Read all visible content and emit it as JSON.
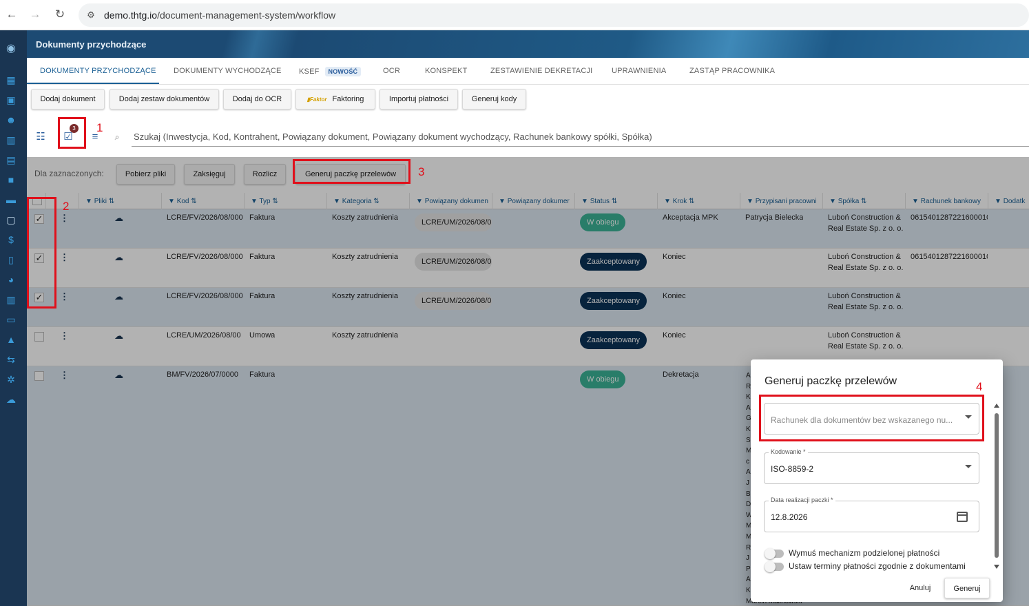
{
  "browser": {
    "url_host": "demo.thtg.io",
    "url_path": "/document-management-system/workflow"
  },
  "app": {
    "title": "Dokumenty przychodzące"
  },
  "tabs": [
    {
      "label": "DOKUMENTY PRZYCHODZĄCE"
    },
    {
      "label": "DOKUMENTY WYCHODZĄCE"
    },
    {
      "label": "KSEF",
      "badge": "NOWOŚĆ"
    },
    {
      "label": "OCR"
    },
    {
      "label": "KONSPEKT"
    },
    {
      "label": "ZESTAWIENIE DEKRETACJI"
    },
    {
      "label": "UPRAWNIENIA"
    },
    {
      "label": "ZASTĄP PRACOWNIKA"
    }
  ],
  "actions": {
    "add_document": "Dodaj dokument",
    "add_set": "Dodaj zestaw dokumentów",
    "add_ocr": "Dodaj do OCR",
    "faktor_logo": "Faktor",
    "factoring": "Faktoring",
    "import_payments": "Importuj płatności",
    "generate_codes": "Generuj kody"
  },
  "search": {
    "placeholder": "Szukaj (Inwestycja, Kod, Kontrahent, Powiązany dokument, Powiązany dokument wychodzący, Rachunek bankowy spółki, Spółka)",
    "selected_count": "3"
  },
  "selection": {
    "label": "Dla zaznaczonych:",
    "download": "Pobierz pliki",
    "post": "Zaksięguj",
    "settle": "Rozlicz",
    "generate_transfers": "Generuj paczkę przelewów"
  },
  "annotations": {
    "n1": "1",
    "n2": "2",
    "n3": "3",
    "n4": "4"
  },
  "columns": [
    "Pliki",
    "Kod",
    "Typ",
    "Kategoria",
    "Powiązany dokumen",
    "Powiązany dokumer",
    "Status",
    "Krok",
    "Przypisani pracowni",
    "Spółka",
    "Rachunek bankowy",
    "Dodatk"
  ],
  "rows": [
    {
      "checked": true,
      "kod": "LCRE/FV/2026/08/000",
      "typ": "Faktura",
      "kategoria": "Koszty zatrudnienia",
      "powiazany": "LCRE/UM/2026/08/0",
      "status": "W obiegu",
      "krok": "Akceptacja MPK",
      "pracownik": "Patrycja Bielecka",
      "spolka": "Luboń Construction & Real Estate Sp. z o. o.",
      "rachunek": "0615401287221600010"
    },
    {
      "checked": true,
      "kod": "LCRE/FV/2026/08/000",
      "typ": "Faktura",
      "kategoria": "Koszty zatrudnienia",
      "powiazany": "LCRE/UM/2026/08/0",
      "status": "Zaakceptowany",
      "krok": "Koniec",
      "pracownik": "",
      "spolka": "Luboń Construction & Real Estate Sp. z o. o.",
      "rachunek": "0615401287221600010"
    },
    {
      "checked": true,
      "kod": "LCRE/FV/2026/08/000",
      "typ": "Faktura",
      "kategoria": "Koszty zatrudnienia",
      "powiazany": "LCRE/UM/2026/08/0",
      "status": "Zaakceptowany",
      "krok": "Koniec",
      "pracownik": "",
      "spolka": "Luboń Construction & Real Estate Sp. z o. o.",
      "rachunek": ""
    },
    {
      "checked": false,
      "kod": "LCRE/UM/2026/08/00",
      "typ": "Umowa",
      "kategoria": "Koszty zatrudnienia",
      "powiazany": "",
      "status": "Zaakceptowany",
      "krok": "Koniec",
      "pracownik": "",
      "spolka": "Luboń Construction & Real Estate Sp. z o. o.",
      "rachunek": ""
    },
    {
      "checked": false,
      "kod": "BM/FV/2026/07/0000",
      "typ": "Faktura",
      "kategoria": "",
      "powiazany": "",
      "status": "W obiegu",
      "krok": "Dekretacja",
      "pracownik": "",
      "spolka": "",
      "rachunek": ""
    }
  ],
  "dialog": {
    "title": "Generuj paczkę przelewów",
    "account_placeholder": "Rachunek dla dokumentów bez wskazanego nu...",
    "encoding_label": "Kodowanie *",
    "encoding_value": "ISO-8859-2",
    "date_label": "Data realizacji paczki *",
    "date_value": "12.8.2026",
    "toggle1": "Wymuś mechanizm podzielonej płatności",
    "toggle2": "Ustaw terminy płatności zgodnie z dokumentami",
    "cancel": "Anuluj",
    "generate": "Generuj"
  },
  "peek_initials": [
    "A",
    "R",
    "K",
    "A",
    "G",
    "K",
    "S",
    "M",
    "c",
    "A",
    "J",
    "B",
    "D",
    "W",
    "M",
    "M",
    "R",
    "J",
    "P",
    "A",
    "K"
  ],
  "peek_bottom": "Marcin Malinowski"
}
